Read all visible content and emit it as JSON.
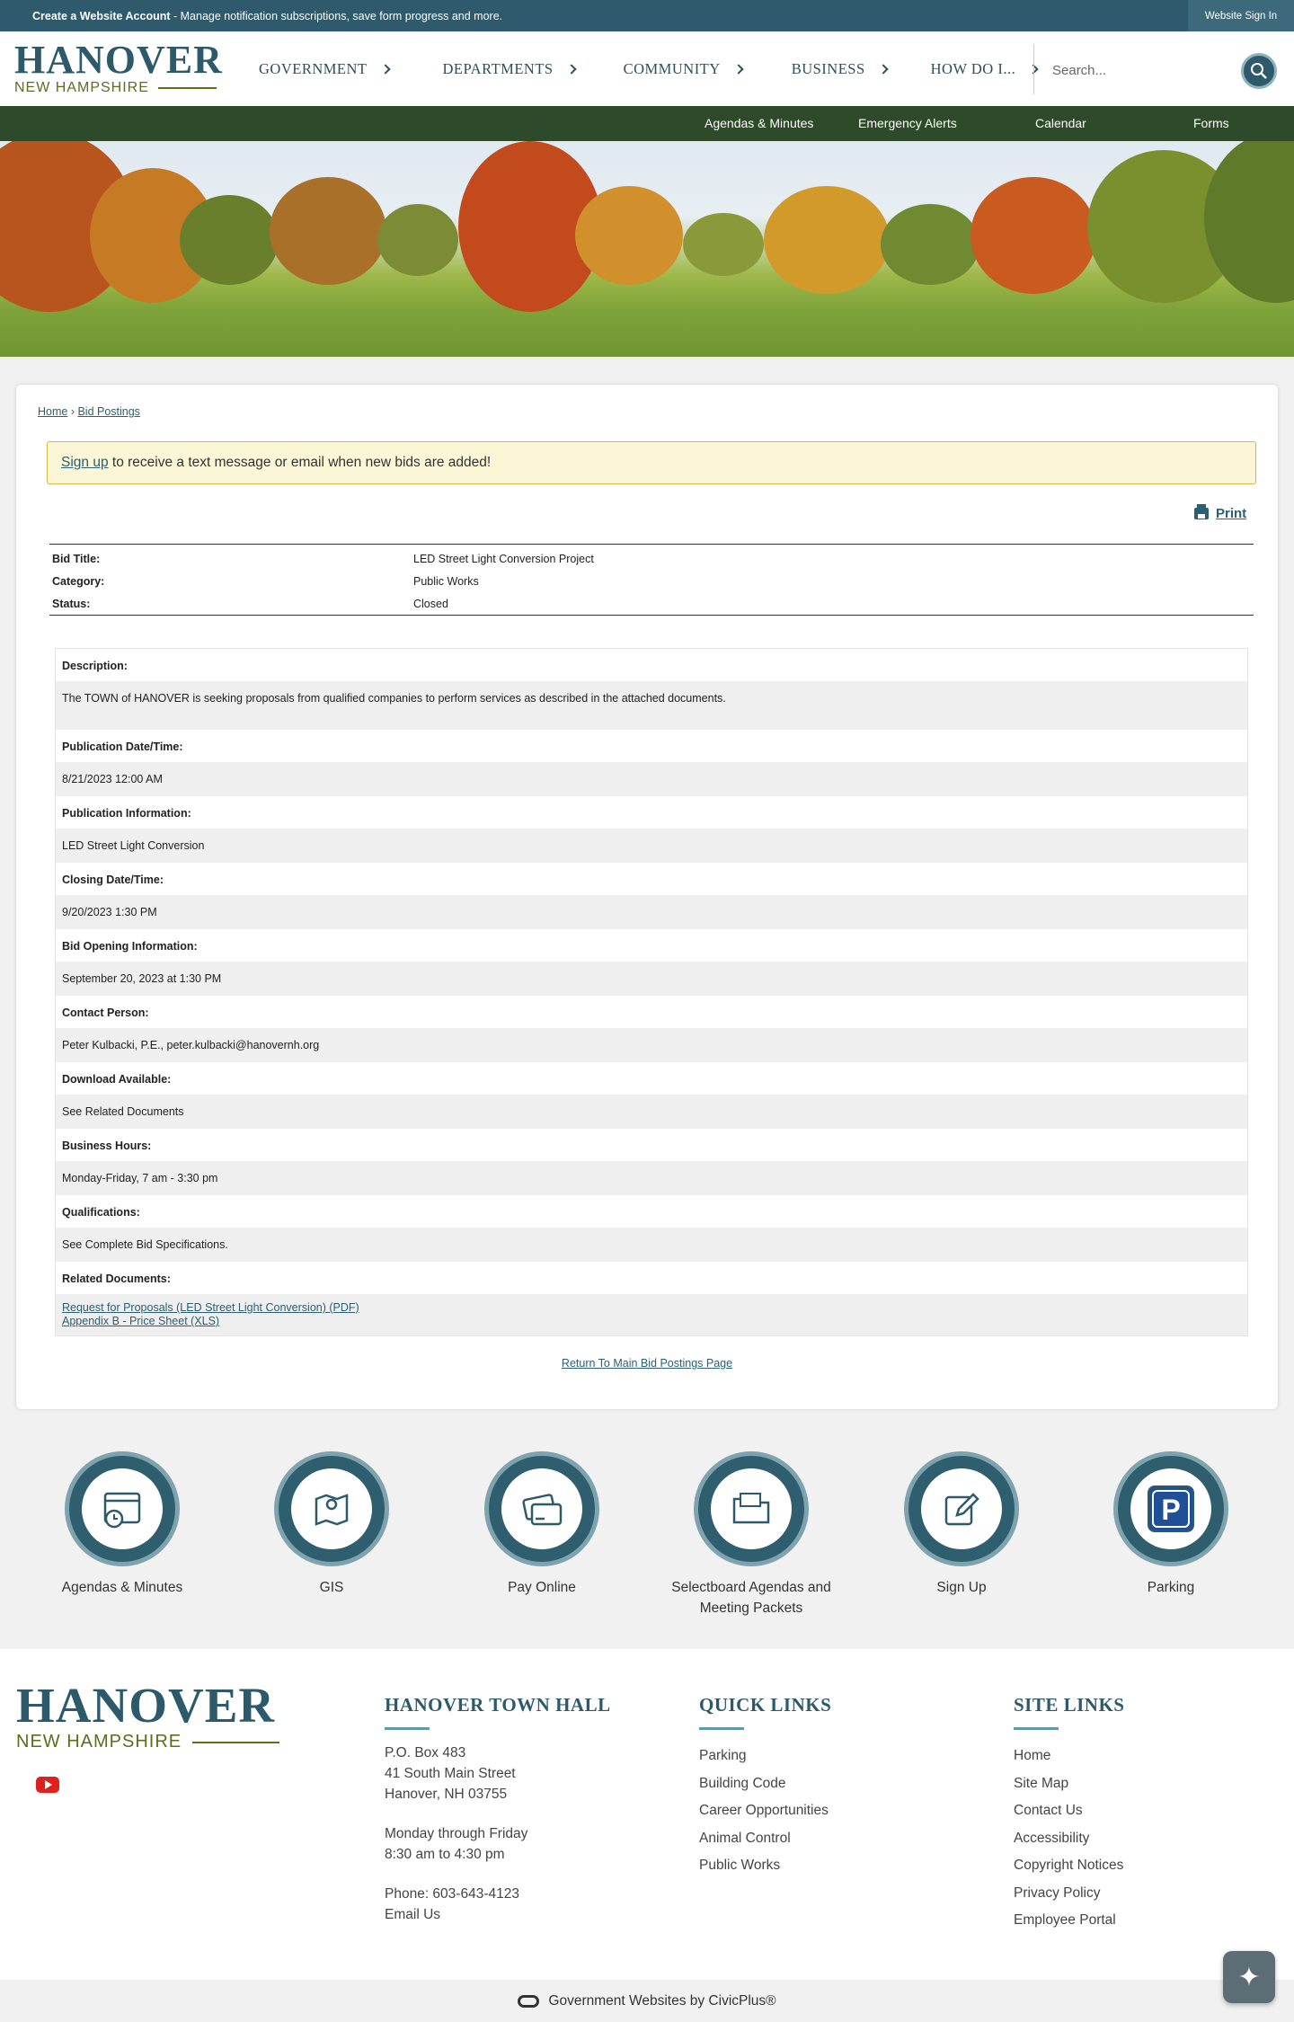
{
  "topbar": {
    "create_bold": "Create a Website Account",
    "create_rest": " - Manage notification subscriptions, save form progress and more.",
    "signin": "Website Sign In"
  },
  "logo": {
    "line1": "HANOVER",
    "line2": "NEW HAMPSHIRE"
  },
  "nav": [
    {
      "label": "GOVERNMENT"
    },
    {
      "label": "DEPARTMENTS"
    },
    {
      "label": "COMMUNITY"
    },
    {
      "label": "BUSINESS"
    },
    {
      "label": "HOW DO I..."
    }
  ],
  "search": {
    "placeholder": "Search..."
  },
  "subnav": [
    "Agendas & Minutes",
    "Emergency Alerts",
    "Calendar",
    "Forms"
  ],
  "breadcrumb": {
    "home": "Home",
    "sep": " › ",
    "current": "Bid Postings"
  },
  "alert": {
    "link": "Sign up",
    "text": " to receive a text message or email when new bids are added!"
  },
  "print_label": "Print",
  "summary": [
    {
      "key": "Bid Title:",
      "value": "LED Street Light Conversion Project"
    },
    {
      "key": "Category:",
      "value": "Public Works"
    },
    {
      "key": "Status:",
      "value": "Closed"
    }
  ],
  "details": [
    {
      "label": "Description:",
      "value": "The TOWN of HANOVER is seeking proposals from qualified companies to perform services as described in the attached documents."
    },
    {
      "label": "Publication Date/Time:",
      "value": "8/21/2023 12:00 AM"
    },
    {
      "label": "Publication Information:",
      "value": "LED Street Light Conversion"
    },
    {
      "label": "Closing Date/Time:",
      "value": "9/20/2023 1:30 PM"
    },
    {
      "label": "Bid Opening Information:",
      "value": "September 20, 2023 at 1:30 PM"
    },
    {
      "label": "Contact Person:",
      "value": "Peter Kulbacki, P.E., peter.kulbacki@hanovernh.org"
    },
    {
      "label": "Download Available:",
      "value": "See Related Documents"
    },
    {
      "label": "Business Hours:",
      "value": "Monday-Friday, 7 am - 3:30 pm"
    },
    {
      "label": "Qualifications:",
      "value": "See Complete Bid Specifications."
    }
  ],
  "related": {
    "label": "Related Documents:",
    "docs": [
      "Request for Proposals (LED Street Light Conversion) (PDF)",
      "Appendix B - Price Sheet (XLS)"
    ]
  },
  "return_link": "Return To Main Bid Postings Page",
  "quick_links": [
    {
      "label": "Agendas & Minutes",
      "icon": "calendar-clock-icon"
    },
    {
      "label": "GIS",
      "icon": "map-pin-icon"
    },
    {
      "label": "Pay Online",
      "icon": "credit-card-icon"
    },
    {
      "label": "Selectboard Agendas and Meeting Packets",
      "icon": "folder-icon"
    },
    {
      "label": "Sign Up",
      "icon": "pencil-icon"
    },
    {
      "label": "Parking",
      "icon": "parking-icon"
    }
  ],
  "footer": {
    "town_hall": {
      "title": "HANOVER TOWN HALL",
      "address": [
        "P.O. Box 483",
        "41 South Main Street",
        "Hanover, NH 03755"
      ],
      "hours": [
        "Monday through Friday",
        "8:30 am to 4:30 pm"
      ],
      "phone": "Phone: 603-643-4123",
      "email": "Email Us"
    },
    "quick": {
      "title": "QUICK LINKS",
      "links": [
        "Parking",
        "Building Code",
        "Career Opportunities",
        "Animal Control",
        "Public Works"
      ]
    },
    "site": {
      "title": "SITE LINKS",
      "links": [
        "Home",
        "Site Map",
        "Contact Us",
        "Accessibility",
        "Copyright Notices",
        "Privacy Policy",
        "Employee Portal"
      ]
    },
    "credit": "Government Websites by CivicPlus®"
  },
  "colors": {
    "primary": "#2f5a6b",
    "subnav": "#2e4a2a",
    "accent_green": "#5a6e1e",
    "alert_bg": "#fbf6d6"
  }
}
